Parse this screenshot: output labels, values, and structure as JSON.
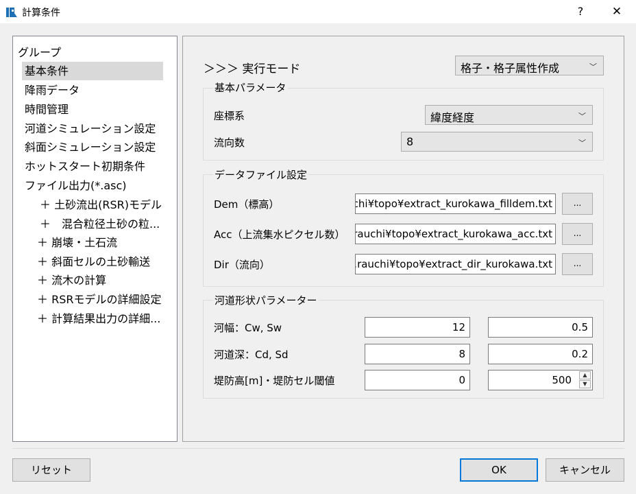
{
  "window": {
    "title": "計算条件",
    "help": "?",
    "close": "✕"
  },
  "tree": {
    "header": "グループ",
    "items": [
      {
        "label": "基本条件"
      },
      {
        "label": "降雨データ"
      },
      {
        "label": "時間管理"
      },
      {
        "label": "河道シミュレーション設定"
      },
      {
        "label": "斜面シミュレーション設定"
      },
      {
        "label": "ホットスタート初期条件"
      },
      {
        "label": "ファイル出力(*.asc)"
      },
      {
        "label": "＋ 土砂流出(RSR)モデル"
      },
      {
        "label": "＋　混合粒径土砂の粒..."
      },
      {
        "label": "＋ 崩壊・土石流"
      },
      {
        "label": "＋ 斜面セルの土砂輸送"
      },
      {
        "label": "＋ 流木の計算"
      },
      {
        "label": "＋ RSRモデルの詳細設定"
      },
      {
        "label": "＋ 計算結果出力の詳細..."
      }
    ]
  },
  "main": {
    "mode_label": "＞＞＞ 実行モード",
    "mode_value": "格子・格子属性作成",
    "chevron": "﹀",
    "basic": {
      "title": "基本パラメータ",
      "coord_label": "座標系",
      "coord_value": "緯度経度",
      "flowdir_label": "流向数",
      "flowdir_value": "8"
    },
    "files": {
      "title": "データファイル設定",
      "dem_label": "Dem（標高）",
      "dem_value": "...chi¥topo¥extract_kurokawa_filldem.txt",
      "acc_label": "Acc（上流集水ピクセル数）",
      "acc_value": "...rauchi¥topo¥extract_kurokawa_acc.txt",
      "dir_label": "Dir（流向）",
      "dir_value": "...rauchi¥topo¥extract_dir_kurokawa.txt",
      "browse": "..."
    },
    "channel": {
      "title": "河道形状パラメーター",
      "width_label": "河幅：Cw, Sw",
      "width_cw": "12",
      "width_sw": "0.5",
      "depth_label": "河道深：Cd, Sd",
      "depth_cd": "8",
      "depth_sd": "0.2",
      "levee_label": "堤防高[m]・堤防セル閾値",
      "levee_h": "0",
      "levee_th": "500",
      "spin_up": "▲",
      "spin_down": "▼"
    }
  },
  "buttons": {
    "reset": "リセット",
    "ok": "OK",
    "cancel": "キャンセル"
  },
  "colors": {
    "accent": "#0078d7",
    "selected": "#d9d9d9"
  }
}
